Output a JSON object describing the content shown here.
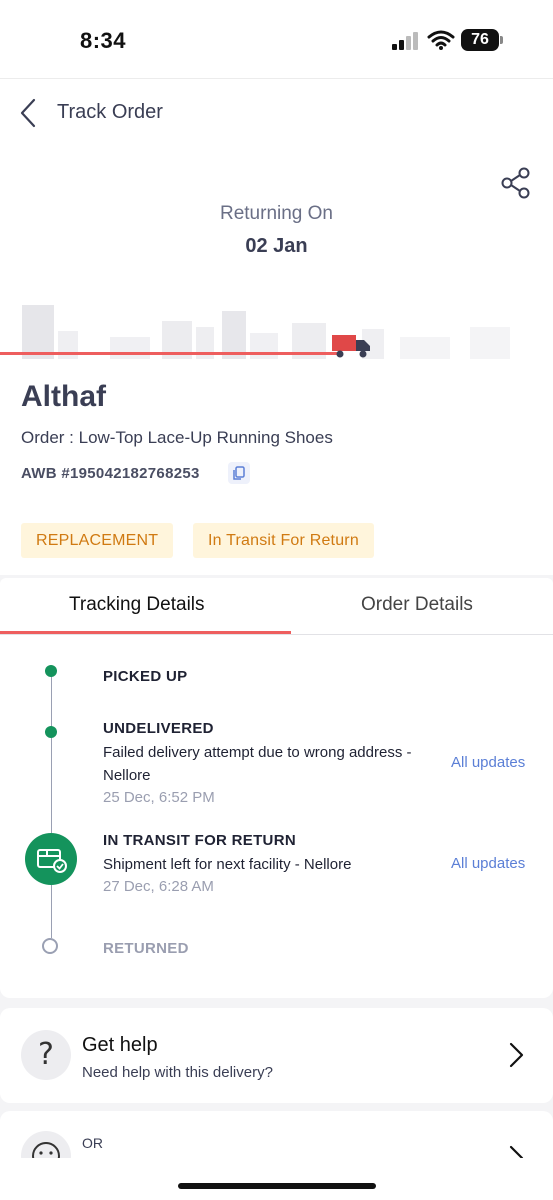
{
  "status_bar": {
    "time": "8:34",
    "battery": "76"
  },
  "header": {
    "title": "Track Order"
  },
  "shipment": {
    "returning_label": "Returning On",
    "returning_date": "02 Jan",
    "customer_name": "Althaf",
    "order_line": "Order : Low-Top Lace-Up Running Shoes",
    "awb": "AWB #195042182768253",
    "badges": [
      "REPLACEMENT",
      "In Transit For Return"
    ],
    "progress_fraction": 0.61
  },
  "tabs": [
    {
      "label": "Tracking Details",
      "active": true
    },
    {
      "label": "Order Details",
      "active": false
    }
  ],
  "timeline": [
    {
      "title": "PICKED UP",
      "status": "done"
    },
    {
      "title": "UNDELIVERED",
      "status": "done",
      "description": "Failed delivery attempt due to wrong address - Nellore",
      "time": "25 Dec, 6:52 PM",
      "link": "All updates"
    },
    {
      "title": "IN TRANSIT FOR RETURN",
      "status": "current",
      "description": "Shipment left for next facility - Nellore",
      "time": "27 Dec, 6:28 AM",
      "link": "All updates"
    },
    {
      "title": "RETURNED",
      "status": "pending"
    }
  ],
  "help": {
    "title": "Get help",
    "subtitle": "Need help with this delivery?",
    "icon": "question-icon"
  },
  "second_card": {
    "label": "OR"
  },
  "colors": {
    "accent_red": "#ee5e5e",
    "success_green": "#14935c",
    "badge_text": "#d07a12",
    "badge_bg": "#fff5dc",
    "link_blue": "#5b7fd6"
  }
}
